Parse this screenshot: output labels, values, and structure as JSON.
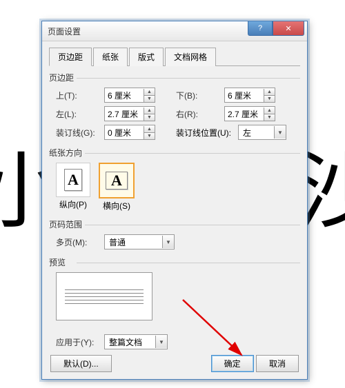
{
  "title": "页面设置",
  "tabs": [
    "页边距",
    "纸张",
    "版式",
    "文档网格"
  ],
  "margins": {
    "group_label": "页边距",
    "top_label": "上(T):",
    "top_value": "6 厘米",
    "bottom_label": "下(B):",
    "bottom_value": "6 厘米",
    "left_label": "左(L):",
    "left_value": "2.7 厘米",
    "right_label": "右(R):",
    "right_value": "2.7 厘米",
    "gutter_label": "装订线(G):",
    "gutter_value": "0 厘米",
    "gutter_pos_label": "装订线位置(U):",
    "gutter_pos_value": "左"
  },
  "orientation": {
    "group_label": "纸张方向",
    "portrait": "纵向(P)",
    "landscape": "横向(S)"
  },
  "pages": {
    "group_label": "页码范围",
    "multi_label": "多页(M):",
    "multi_value": "普通"
  },
  "preview": {
    "group_label": "预览"
  },
  "apply": {
    "label": "应用于(Y):",
    "value": "整篇文档"
  },
  "buttons": {
    "default": "默认(D)...",
    "ok": "确定",
    "cancel": "取消"
  }
}
